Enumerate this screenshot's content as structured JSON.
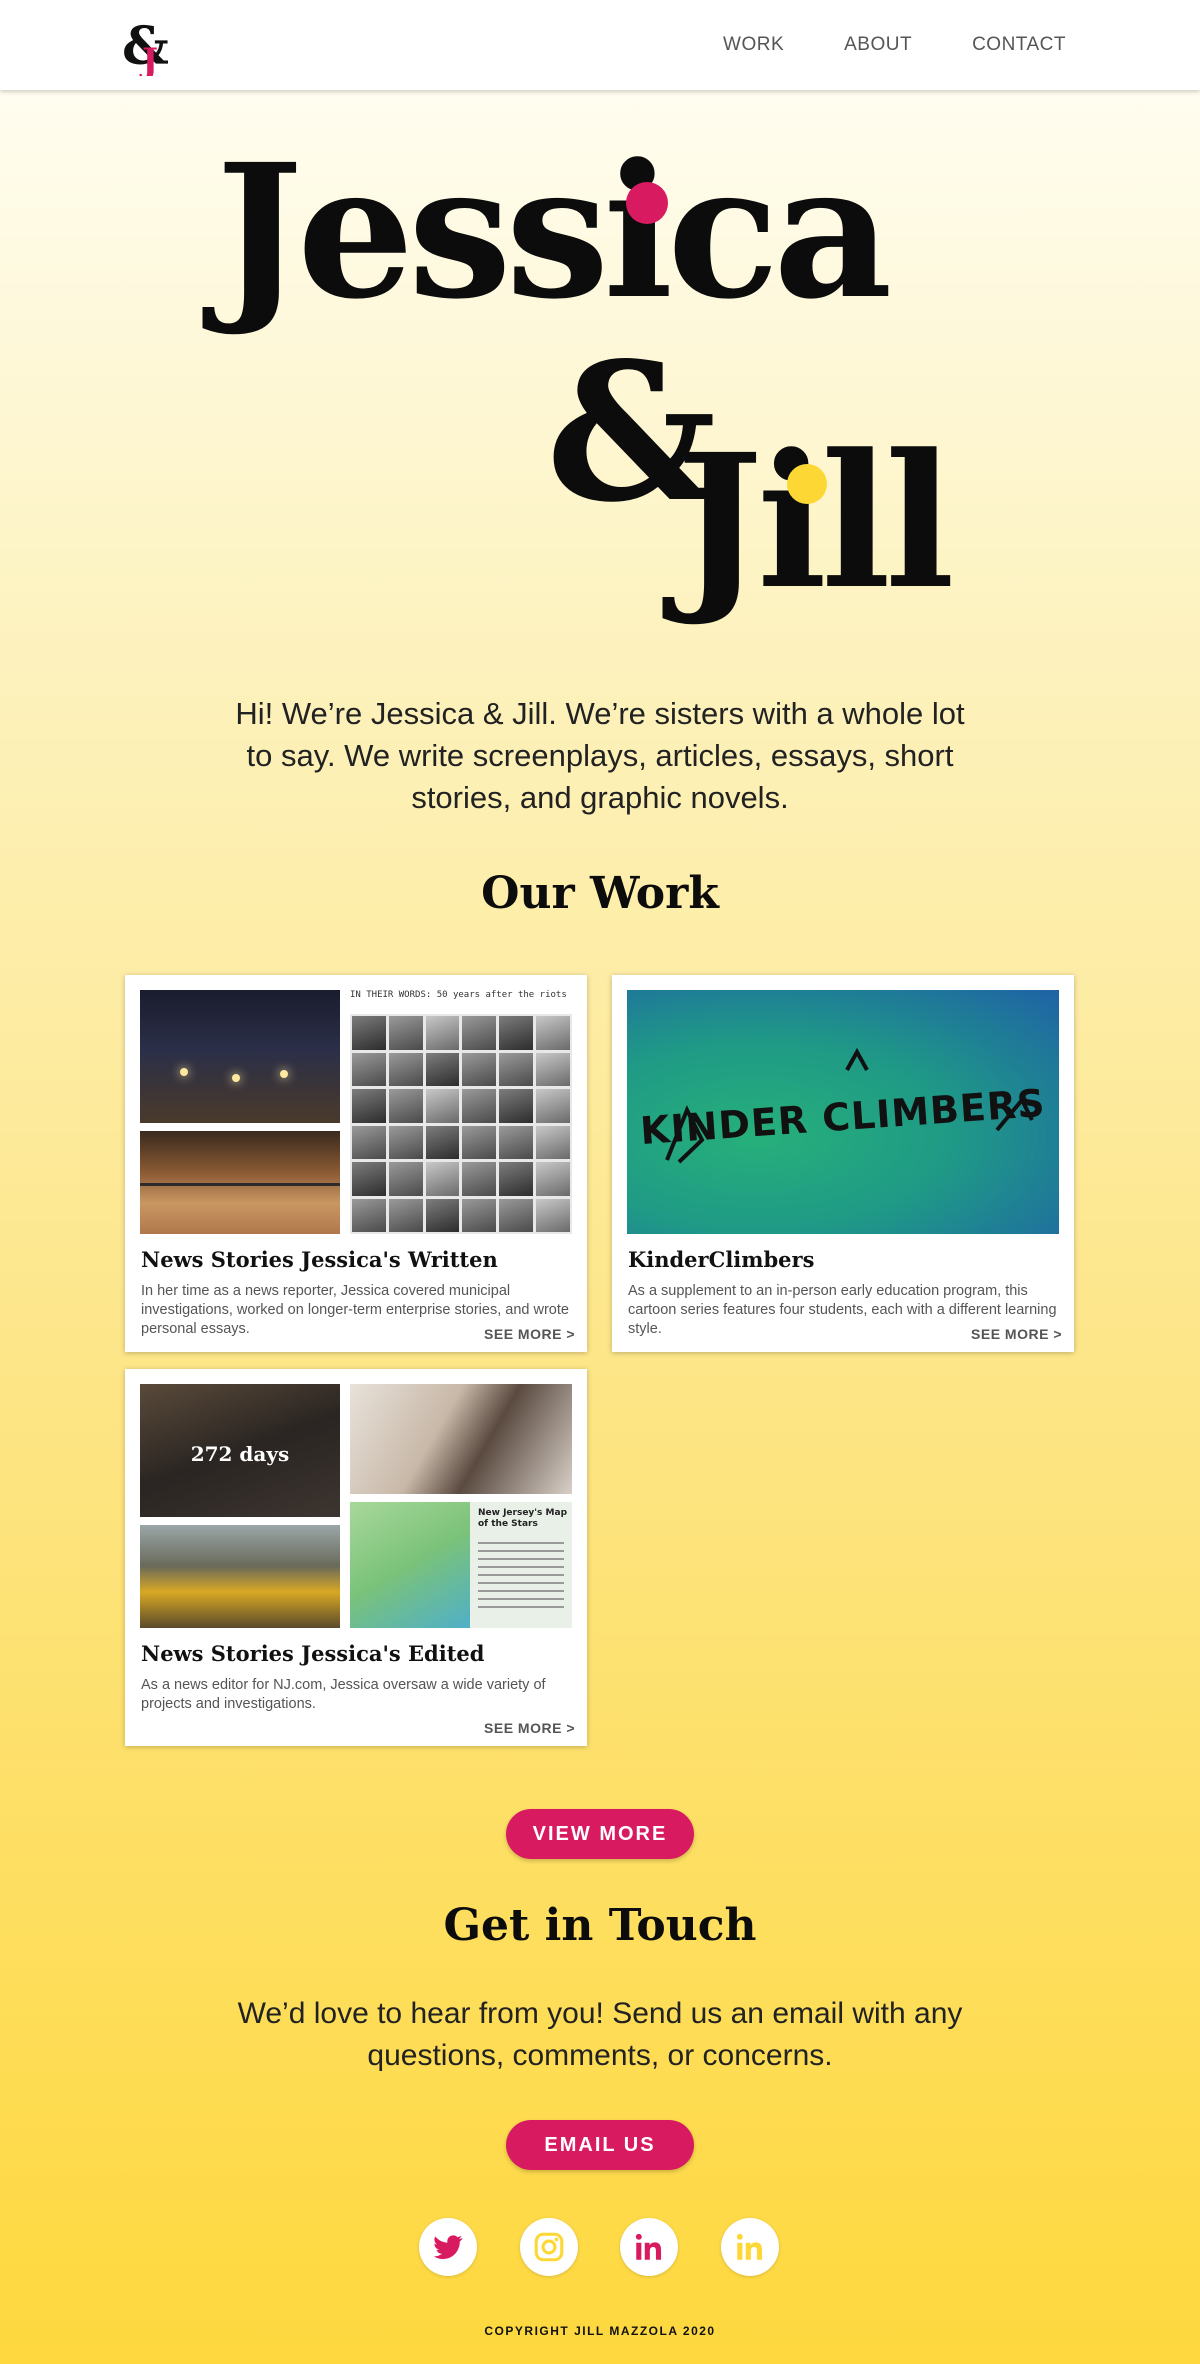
{
  "header": {
    "logo_text": "&J",
    "nav": [
      "WORK",
      "ABOUT",
      "CONTACT"
    ]
  },
  "hero": {
    "line1": "Jessica",
    "amp": "&",
    "line2": "Jill",
    "intro": "Hi! We’re Jessica & Jill. We’re sisters with a whole lot to say. We write screenplays, articles, essays, short stories, and graphic novels."
  },
  "work": {
    "title": "Our Work",
    "cards": [
      {
        "title": "News Stories Jessica's Written",
        "description": "In her time as a news reporter, Jessica covered municipal investigations, worked on longer-term enterprise stories, and wrote personal essays.",
        "link": "SEE MORE >",
        "media_caption": "IN THEIR WORDS: 50 years after the riots"
      },
      {
        "title": "KinderClimbers",
        "description": "As a supplement to an in-person early education program, this cartoon series features four students, each with a different learning style.",
        "link": "SEE MORE >",
        "media_caption": "KINDER CLIMBERS"
      },
      {
        "title": "News Stories Jessica's Edited",
        "description": "As a news editor for NJ.com, Jessica oversaw a wide variety of projects and investigations.",
        "link": "SEE MORE >",
        "media_caption": "272 days",
        "map_caption": "New Jersey's Map of the Stars"
      }
    ],
    "view_more": "VIEW MORE"
  },
  "contact": {
    "title": "Get in Touch",
    "text": "We’d love to hear from you! Send us an email with any questions, comments, or concerns.",
    "email_button": "EMAIL US"
  },
  "social": [
    {
      "icon": "twitter-icon",
      "color": "#d81b60"
    },
    {
      "icon": "instagram-icon",
      "color": "#fdd835"
    },
    {
      "icon": "linkedin-icon",
      "color": "#d81b60"
    },
    {
      "icon": "linkedin-icon",
      "color": "#fdd835"
    }
  ],
  "footer": {
    "copyright": "COPYRIGHT JILL MAZZOLA 2020"
  },
  "colors": {
    "accent_pink": "#d81b60",
    "accent_yellow": "#fdd835"
  }
}
